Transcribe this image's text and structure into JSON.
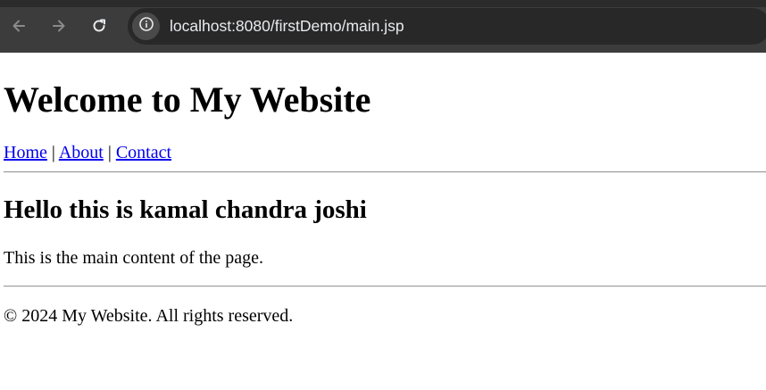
{
  "browser": {
    "url": "localhost:8080/firstDemo/main.jsp",
    "icons": {
      "back": "arrow-left-icon",
      "forward": "arrow-right-icon",
      "reload": "reload-icon",
      "site_info": "info-icon"
    }
  },
  "page": {
    "heading": "Welcome to My Website",
    "nav": {
      "home": "Home",
      "about": "About",
      "contact": "Contact",
      "separator": "|"
    },
    "main_heading": "Hello this is kamal chandra joshi",
    "main_text": "This is the main content of the page.",
    "footer": "© 2024 My Website. All rights reserved."
  },
  "colors": {
    "link": "#0000ee",
    "chrome_bg": "#3c3c3c",
    "omnibox_bg": "#282828"
  }
}
